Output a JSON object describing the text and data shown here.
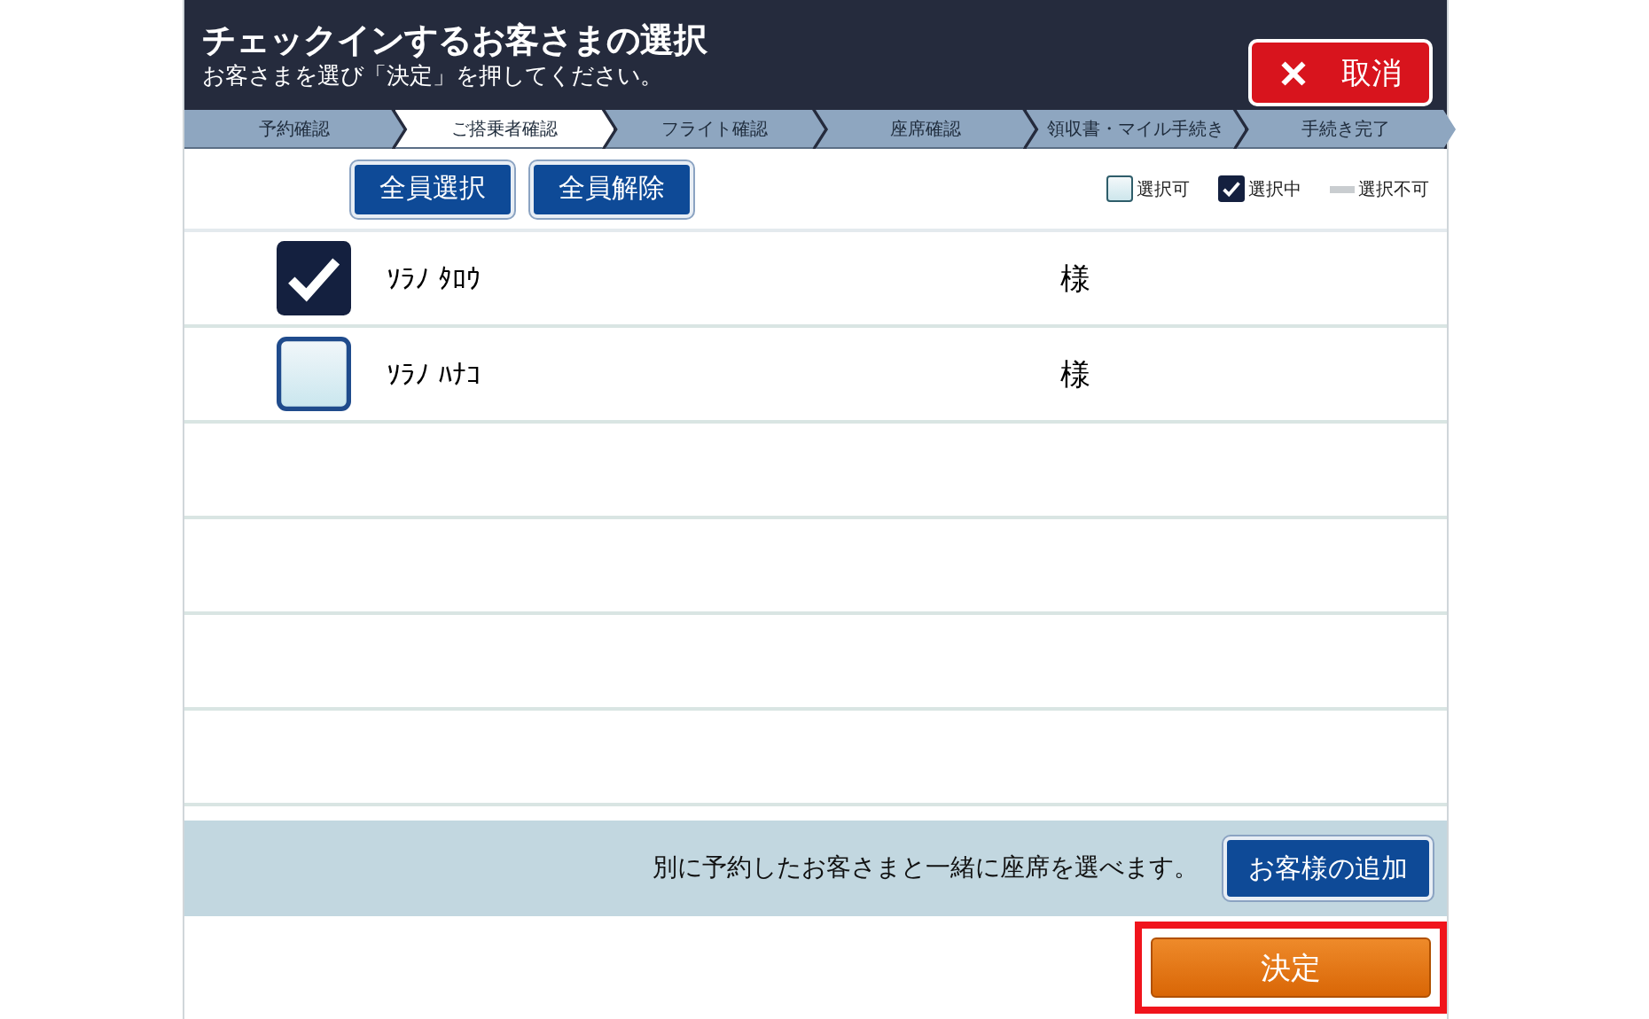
{
  "header": {
    "title": "チェックインするお客さまの選択",
    "subtitle": "お客さまを選び「決定」を押してください。",
    "cancel_button": "取消"
  },
  "steps": [
    {
      "label": "予約確認",
      "selected": false
    },
    {
      "label": "ご搭乗者確認",
      "selected": true
    },
    {
      "label": "フライト確認",
      "selected": false
    },
    {
      "label": "座席確認",
      "selected": false
    },
    {
      "label": "領収書・マイル手続き",
      "selected": false
    },
    {
      "label": "手続き完了",
      "selected": false
    }
  ],
  "toolbar": {
    "buttons": [
      "全員選択",
      "全員解除"
    ]
  },
  "legend": [
    {
      "kind": "available",
      "label": "選択可"
    },
    {
      "kind": "selected",
      "label": "選択中"
    },
    {
      "kind": "unavailable",
      "label": "選択不可"
    }
  ],
  "passengers": [
    {
      "name": "ｿﾗﾉ ﾀﾛｳ",
      "honorific": "様",
      "checked": true
    },
    {
      "name": "ｿﾗﾉ ﾊﾅｺ",
      "honorific": "様",
      "checked": false
    }
  ],
  "footer": {
    "note": "別に予約したお客さまと一緒に座席を選べます。",
    "add_button": "お客様の追加"
  },
  "confirm_button": {
    "label": "決定",
    "highlighted": true
  }
}
